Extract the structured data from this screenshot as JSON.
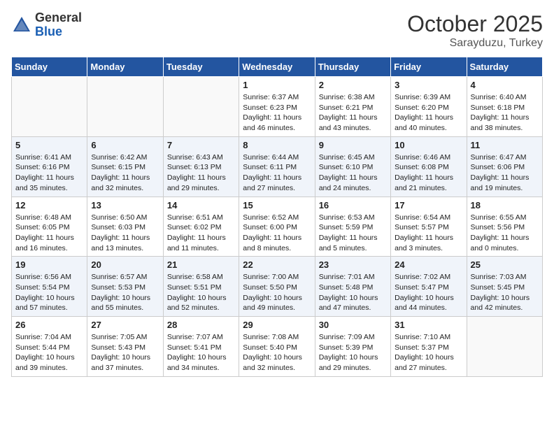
{
  "logo": {
    "general": "General",
    "blue": "Blue"
  },
  "header": {
    "month": "October 2025",
    "location": "Sarayduzu, Turkey"
  },
  "weekdays": [
    "Sunday",
    "Monday",
    "Tuesday",
    "Wednesday",
    "Thursday",
    "Friday",
    "Saturday"
  ],
  "weeks": [
    [
      {
        "day": "",
        "info": ""
      },
      {
        "day": "",
        "info": ""
      },
      {
        "day": "",
        "info": ""
      },
      {
        "day": "1",
        "info": "Sunrise: 6:37 AM\nSunset: 6:23 PM\nDaylight: 11 hours\nand 46 minutes."
      },
      {
        "day": "2",
        "info": "Sunrise: 6:38 AM\nSunset: 6:21 PM\nDaylight: 11 hours\nand 43 minutes."
      },
      {
        "day": "3",
        "info": "Sunrise: 6:39 AM\nSunset: 6:20 PM\nDaylight: 11 hours\nand 40 minutes."
      },
      {
        "day": "4",
        "info": "Sunrise: 6:40 AM\nSunset: 6:18 PM\nDaylight: 11 hours\nand 38 minutes."
      }
    ],
    [
      {
        "day": "5",
        "info": "Sunrise: 6:41 AM\nSunset: 6:16 PM\nDaylight: 11 hours\nand 35 minutes."
      },
      {
        "day": "6",
        "info": "Sunrise: 6:42 AM\nSunset: 6:15 PM\nDaylight: 11 hours\nand 32 minutes."
      },
      {
        "day": "7",
        "info": "Sunrise: 6:43 AM\nSunset: 6:13 PM\nDaylight: 11 hours\nand 29 minutes."
      },
      {
        "day": "8",
        "info": "Sunrise: 6:44 AM\nSunset: 6:11 PM\nDaylight: 11 hours\nand 27 minutes."
      },
      {
        "day": "9",
        "info": "Sunrise: 6:45 AM\nSunset: 6:10 PM\nDaylight: 11 hours\nand 24 minutes."
      },
      {
        "day": "10",
        "info": "Sunrise: 6:46 AM\nSunset: 6:08 PM\nDaylight: 11 hours\nand 21 minutes."
      },
      {
        "day": "11",
        "info": "Sunrise: 6:47 AM\nSunset: 6:06 PM\nDaylight: 11 hours\nand 19 minutes."
      }
    ],
    [
      {
        "day": "12",
        "info": "Sunrise: 6:48 AM\nSunset: 6:05 PM\nDaylight: 11 hours\nand 16 minutes."
      },
      {
        "day": "13",
        "info": "Sunrise: 6:50 AM\nSunset: 6:03 PM\nDaylight: 11 hours\nand 13 minutes."
      },
      {
        "day": "14",
        "info": "Sunrise: 6:51 AM\nSunset: 6:02 PM\nDaylight: 11 hours\nand 11 minutes."
      },
      {
        "day": "15",
        "info": "Sunrise: 6:52 AM\nSunset: 6:00 PM\nDaylight: 11 hours\nand 8 minutes."
      },
      {
        "day": "16",
        "info": "Sunrise: 6:53 AM\nSunset: 5:59 PM\nDaylight: 11 hours\nand 5 minutes."
      },
      {
        "day": "17",
        "info": "Sunrise: 6:54 AM\nSunset: 5:57 PM\nDaylight: 11 hours\nand 3 minutes."
      },
      {
        "day": "18",
        "info": "Sunrise: 6:55 AM\nSunset: 5:56 PM\nDaylight: 11 hours\nand 0 minutes."
      }
    ],
    [
      {
        "day": "19",
        "info": "Sunrise: 6:56 AM\nSunset: 5:54 PM\nDaylight: 10 hours\nand 57 minutes."
      },
      {
        "day": "20",
        "info": "Sunrise: 6:57 AM\nSunset: 5:53 PM\nDaylight: 10 hours\nand 55 minutes."
      },
      {
        "day": "21",
        "info": "Sunrise: 6:58 AM\nSunset: 5:51 PM\nDaylight: 10 hours\nand 52 minutes."
      },
      {
        "day": "22",
        "info": "Sunrise: 7:00 AM\nSunset: 5:50 PM\nDaylight: 10 hours\nand 49 minutes."
      },
      {
        "day": "23",
        "info": "Sunrise: 7:01 AM\nSunset: 5:48 PM\nDaylight: 10 hours\nand 47 minutes."
      },
      {
        "day": "24",
        "info": "Sunrise: 7:02 AM\nSunset: 5:47 PM\nDaylight: 10 hours\nand 44 minutes."
      },
      {
        "day": "25",
        "info": "Sunrise: 7:03 AM\nSunset: 5:45 PM\nDaylight: 10 hours\nand 42 minutes."
      }
    ],
    [
      {
        "day": "26",
        "info": "Sunrise: 7:04 AM\nSunset: 5:44 PM\nDaylight: 10 hours\nand 39 minutes."
      },
      {
        "day": "27",
        "info": "Sunrise: 7:05 AM\nSunset: 5:43 PM\nDaylight: 10 hours\nand 37 minutes."
      },
      {
        "day": "28",
        "info": "Sunrise: 7:07 AM\nSunset: 5:41 PM\nDaylight: 10 hours\nand 34 minutes."
      },
      {
        "day": "29",
        "info": "Sunrise: 7:08 AM\nSunset: 5:40 PM\nDaylight: 10 hours\nand 32 minutes."
      },
      {
        "day": "30",
        "info": "Sunrise: 7:09 AM\nSunset: 5:39 PM\nDaylight: 10 hours\nand 29 minutes."
      },
      {
        "day": "31",
        "info": "Sunrise: 7:10 AM\nSunset: 5:37 PM\nDaylight: 10 hours\nand 27 minutes."
      },
      {
        "day": "",
        "info": ""
      }
    ]
  ]
}
